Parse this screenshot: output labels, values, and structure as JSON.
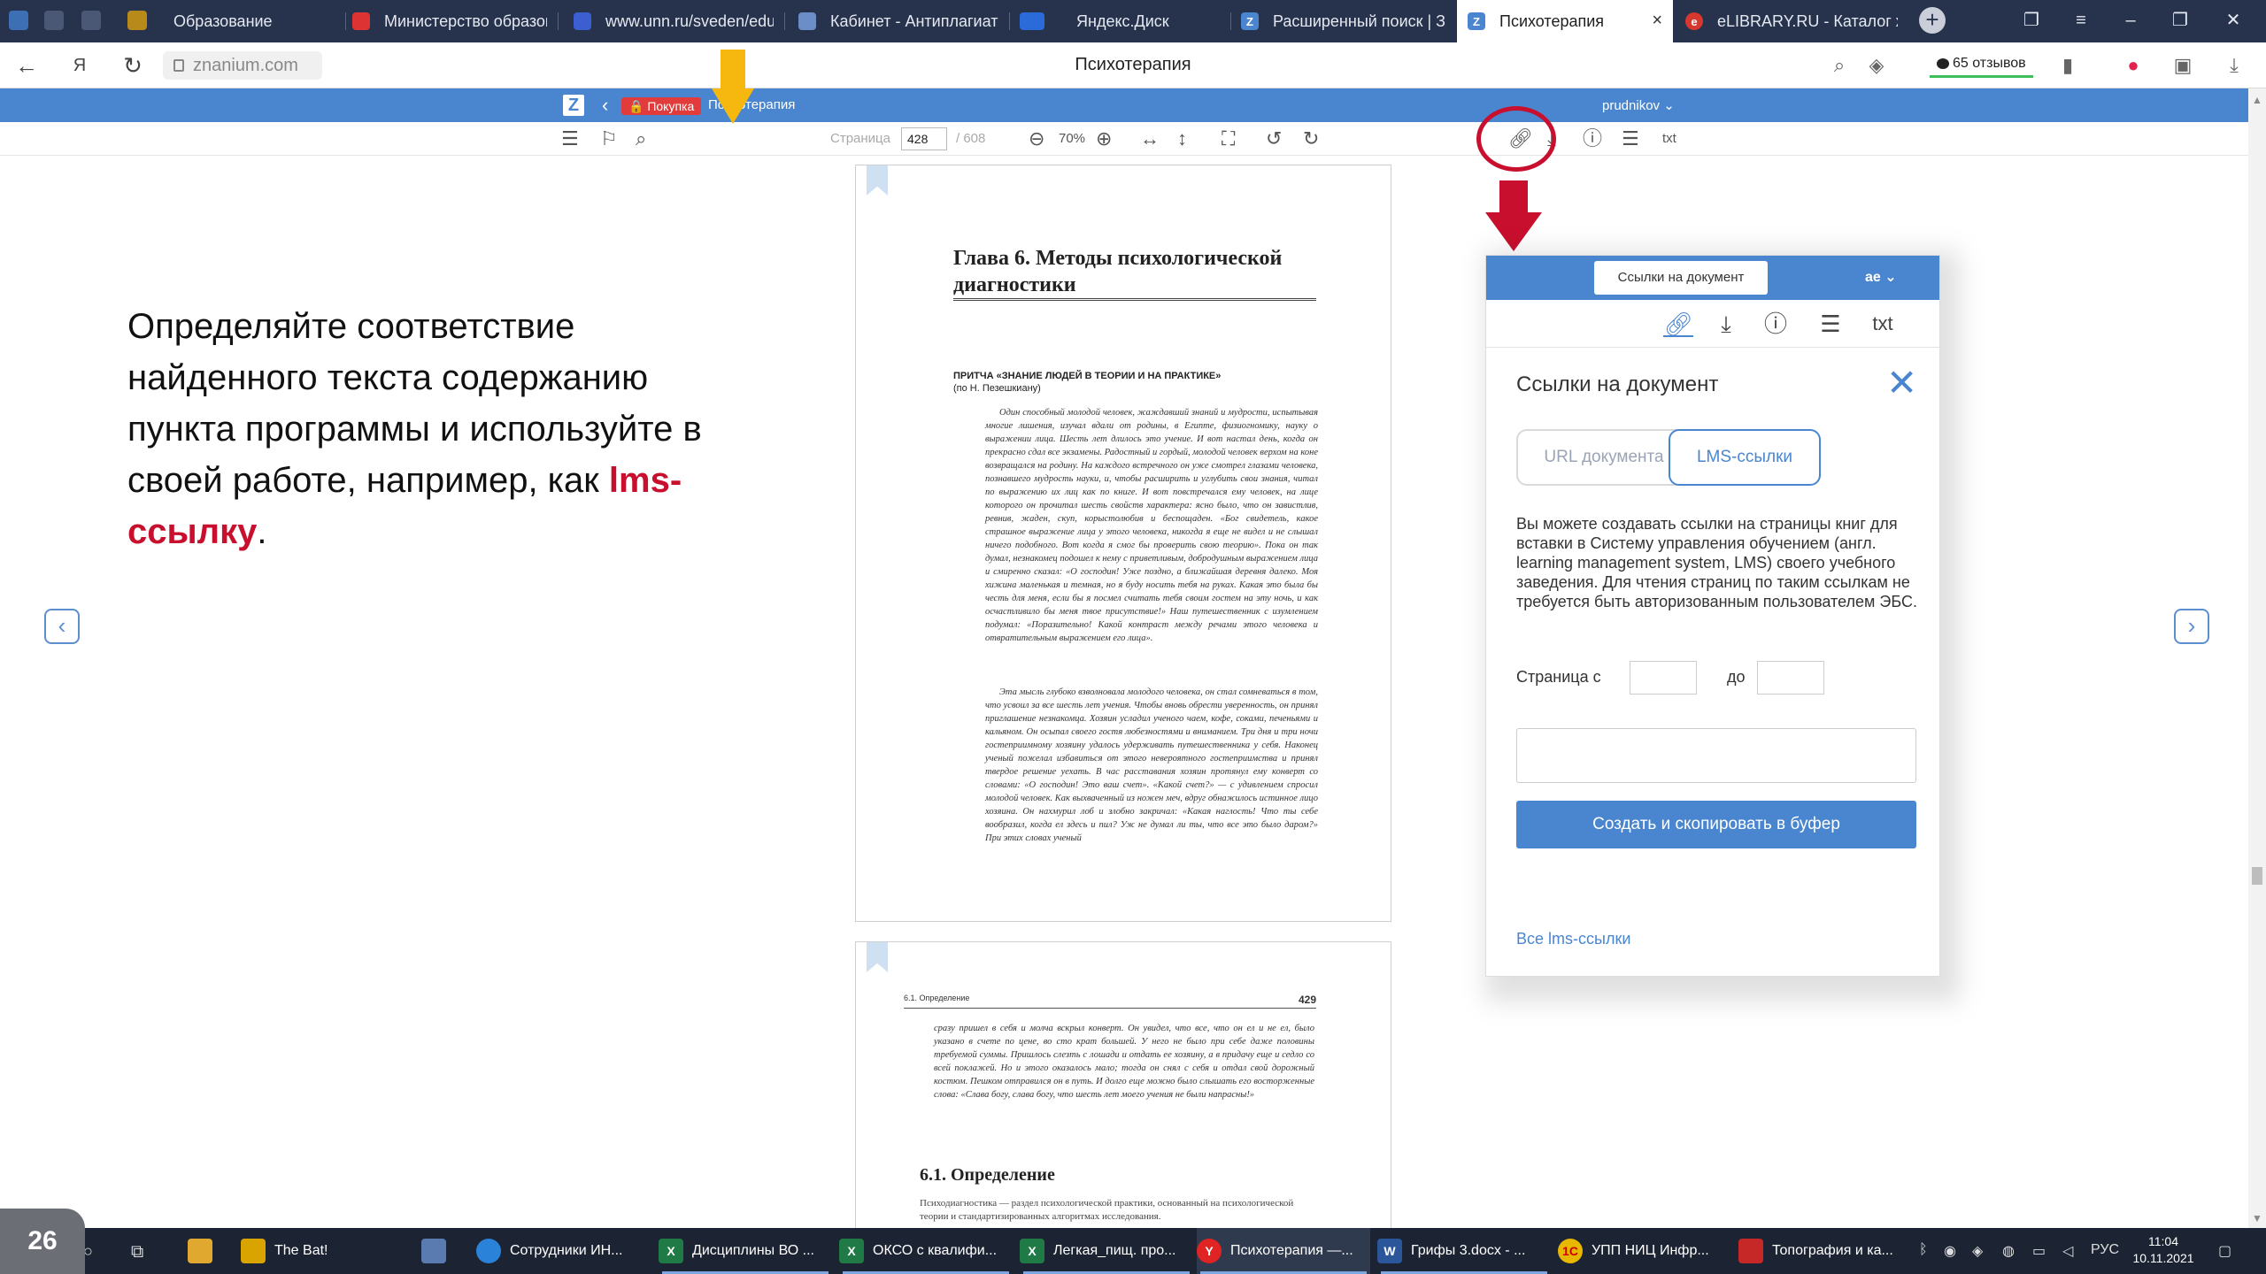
{
  "browser": {
    "tabs": [
      {
        "label": "Образование",
        "icon": "ya-icon"
      },
      {
        "label": "Министерство образов",
        "icon": "document-icon"
      },
      {
        "label": "www.unn.ru/sveden/edu",
        "icon": "shield-icon"
      },
      {
        "label": "Кабинет - Антиплагиат",
        "icon": "shield-icon"
      },
      {
        "label": "Яндекс.Диск",
        "icon": "disk-icon"
      },
      {
        "label": "Расширенный поиск | З",
        "icon": "znanium-icon"
      },
      {
        "label": "Психотерапия",
        "icon": "znanium-icon"
      },
      {
        "label": "eLIBRARY.RU - Каталог ж",
        "icon": "elibrary-icon"
      }
    ],
    "close_glyph": "×",
    "new_tab_glyph": "+",
    "address": "znanium.com",
    "page_title": "Психотерапия",
    "reviews": "65 отзывов"
  },
  "reader": {
    "logo": "Z",
    "buy_label": "Покупка",
    "book_crumb": "Психотерапия",
    "user": "prudnikov",
    "page_label": "Страница",
    "page_value": "428",
    "page_total": "/ 608",
    "zoom": "70%",
    "txt_label": "txt"
  },
  "slide": {
    "text_before": "Определяйте соответствие найденного текста содержанию пункта программы и используйте в своей работе, например, как ",
    "text_accent": "lms-ссылку",
    "text_after": ".",
    "slide_number": "26",
    "accent_color": "#c8102e"
  },
  "page1": {
    "chapter_title": "Глава 6. Методы психологической диагностики",
    "parable_title": "ПРИТЧА «ЗНАНИЕ ЛЮДЕЙ В ТЕОРИИ И НА ПРАКТИКЕ»",
    "parable_author": "(по Н. Пезешкиану)",
    "para1": "Один способный молодой человек, жаждавший знаний и мудрости, испытывая многие лишения, изучал вдали от родины, в Египте, физиогномику, науку о выражении лица. Шесть лет длилось это учение. И вот настал день, когда он прекрасно сдал все экзамены. Радостный и гордый, молодой человек верхом на коне возвращался на родину. На каждого встречного он уже смотрел глазами человека, познавшего мудрость науки, и, чтобы расширить и углубить свои знания, читал по выражению их лиц как по книге. И вот повстречался ему человек, на лице которого он прочитал шесть свойств характера: ясно было, что он завистлив, ревнив, жаден, скуп, корыстолюбив и беспощаден. «Бог свидетель, какое страшное выражение лица у этого человека, никогда я еще не видел и не слышал ничего подобного. Вот когда я смог бы проверить свою теорию». Пока он так думал, незнакомец подошел к нему с приветливым, добродушным выражением лица и смиренно сказал: «О господин! Уже поздно, а ближайшая деревня далеко. Моя хижина маленькая и темная, но я буду носить тебя на руках. Какая это была бы честь для меня, если бы я посмел считать тебя своим гостем на эту ночь, и как осчастливило бы меня твое присутствие!» Наш путешественник с изумлением подумал: «Поразительно! Какой контраст между речами этого человека и отвратительным выражением его лица».",
    "para2": "Эта мысль глубоко взволновала молодого человека, он стал сомневаться в том, что усвоил за все шесть лет учения. Чтобы вновь обрести уверенность, он принял приглашение незнакомца. Хозяин усладил ученого чаем, кофе, соками, печеньями и кальяном. Он осыпал своего гостя любезностями и вниманием. Три дня и три ночи гостеприимному хозяину удалось удерживать путешественника у себя. Наконец ученый пожелал избавиться от этого невероятного гостеприимства и принял твердое решение уехать. В час расставания хозяин протянул ему конверт со словами: «О господин! Это ваш счет». «Какой счет?» — с удивлением спросил молодой человек. Как выхваченный из ножен меч, вдруг обнажилось истинное лицо хозяина. Он нахмурил лоб и злобно закричал: «Какая наглость! Что ты себе вообразил, когда ел здесь и пил? Уж не думал ли ты, что все это было даром?» При этих словах ученый"
  },
  "page2": {
    "running_head": "6.1. Определение",
    "page_number": "429",
    "para1": "сразу пришел в себя и молча вскрыл конверт. Он увидел, что все, что он ел и не ел, было указано в счете по цене, во сто крат большей. У него не было при себе даже половины требуемой суммы. Пришлось слезть с лошади и отдать ее хозяину, а в придачу еще и седло со всей поклажей. Но и этого оказалось мало; тогда он снял с себя и отдал свой дорожный костюм. Пешком отправился он в путь. И долго еще можно было слышать его восторженные слова: «Слава богу, слава богу, что шесть лет моего учения не были напрасны!»",
    "section_title": "6.1. Определение",
    "para2": "Психодиагностика — раздел психологической практики, основанный на психологической теории и стандартизированных алгоритмах исследования."
  },
  "popup": {
    "tooltip": "Ссылки на документ",
    "user": "ae",
    "txt_label": "txt",
    "title": "Ссылки на документ",
    "tab_url": "URL документа",
    "tab_lms": "LMS-ссылки",
    "description": "Вы можете создавать ссылки на страницы книг для вставки в Систему управления обучением (англ. learning management system, LMS) своего учебного заведения. Для чтения страниц по таким ссылкам не требуется быть авторизованным пользователем ЭБС.",
    "page_from_label": "Страница с",
    "page_to_label": "до",
    "create_button": "Создать и скопировать в буфер",
    "all_links": "Все lms-ссылки"
  },
  "taskbar": {
    "items": [
      {
        "label": "The Bat!",
        "color": "#d9a400"
      },
      {
        "label": "",
        "color": "#5a7bb0"
      },
      {
        "label": "Сотрудники ИН...",
        "color": "#2a83d9"
      },
      {
        "label": "Дисциплины ВО ...",
        "color": "#1f7a45"
      },
      {
        "label": "ОКСО с квалифи...",
        "color": "#1f7a45"
      },
      {
        "label": "Легкая_пищ. про...",
        "color": "#1f7a45"
      },
      {
        "label": "Психотерапия —...",
        "color": "#e02424"
      },
      {
        "label": "Грифы 3.docx - ...",
        "color": "#2b579a"
      },
      {
        "label": "УПП НИЦ Инфр...",
        "color": "#e8b800"
      },
      {
        "label": "Топография и ка...",
        "color": "#c62828"
      }
    ],
    "language": "РУС",
    "time": "11:04",
    "date": "10.11.2021"
  }
}
